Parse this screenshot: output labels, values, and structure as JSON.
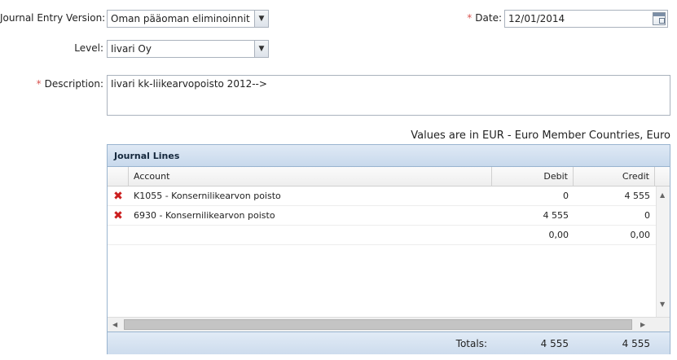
{
  "form": {
    "journal_version_label": "Journal Entry Version:",
    "journal_version_value": "Oman pääoman eliminoinnit",
    "date_label": "Date:",
    "date_value": "12/01/2014",
    "level_label": "Level:",
    "level_value": "Iivari Oy",
    "description_label": "Description:",
    "description_value": "Iivari kk-liikearvopoisto 2012-->",
    "required_mark": "*"
  },
  "currency_note": "Values are in EUR - Euro Member Countries, Euro",
  "grid": {
    "title": "Journal Lines",
    "columns": {
      "account": "Account",
      "debit": "Debit",
      "credit": "Credit"
    },
    "rows": [
      {
        "account": "K1055 - Konsernilikearvon poisto",
        "debit": "0",
        "credit": "4 555"
      },
      {
        "account": "6930 - Konsernilikearvon poisto",
        "debit": "4 555",
        "credit": "0"
      }
    ],
    "sum_row": {
      "debit": "0,00",
      "credit": "0,00"
    },
    "totals": {
      "label": "Totals:",
      "debit": "4 555",
      "credit": "4 555"
    }
  },
  "icons": {
    "delete": "delete-icon",
    "dropdown": "chevron-down-icon",
    "calendar": "calendar-icon"
  },
  "colors": {
    "header_bg": "#c8d9ec",
    "border": "#99b4cf",
    "delete": "#cc1f1f",
    "required": "#d9534f"
  }
}
